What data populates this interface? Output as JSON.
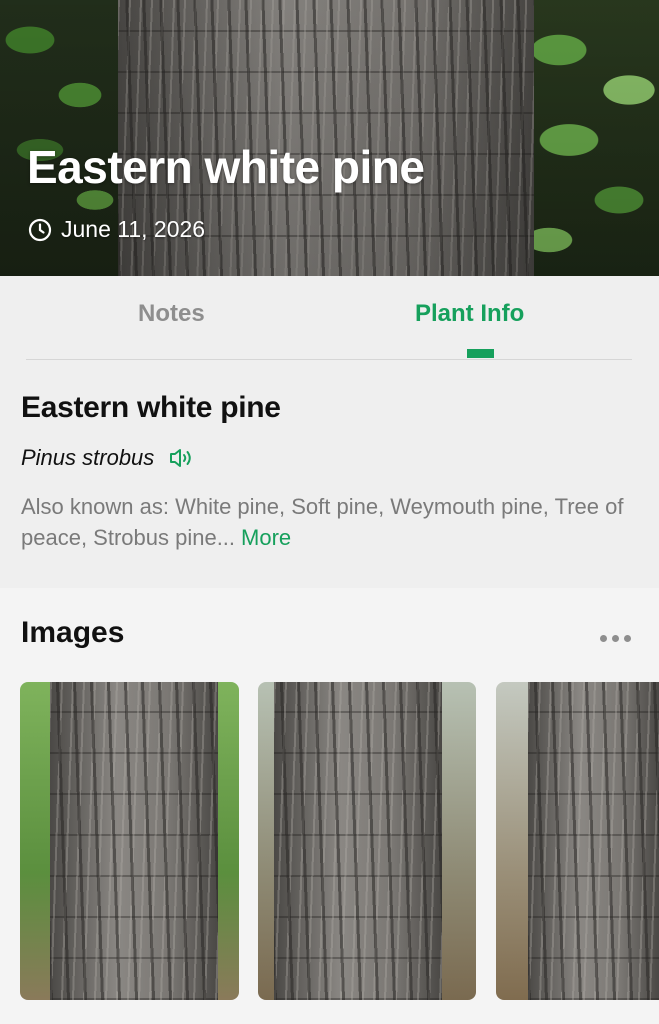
{
  "hero": {
    "title": "Eastern white pine",
    "date": "June 11, 2026",
    "date_icon": "clock-icon"
  },
  "tabs": [
    {
      "label": "Notes",
      "active": false
    },
    {
      "label": "Plant Info",
      "active": true
    }
  ],
  "plant": {
    "common_name": "Eastern white pine",
    "scientific_name": "Pinus strobus",
    "pronounce_icon": "speaker-icon",
    "also_known_as": "Also known as: White pine, Soft pine, Weymouth pine, Tree of peace, Strobus pine...",
    "more_label": "More"
  },
  "images_section": {
    "title": "Images",
    "menu_icon": "more-dots-icon",
    "thumbnail_count_visible": 3
  },
  "colors": {
    "accent": "#16a05c",
    "inactive_tab": "#8e8e8e",
    "secondary_text": "#7a7a7a",
    "background": "#efefef"
  }
}
